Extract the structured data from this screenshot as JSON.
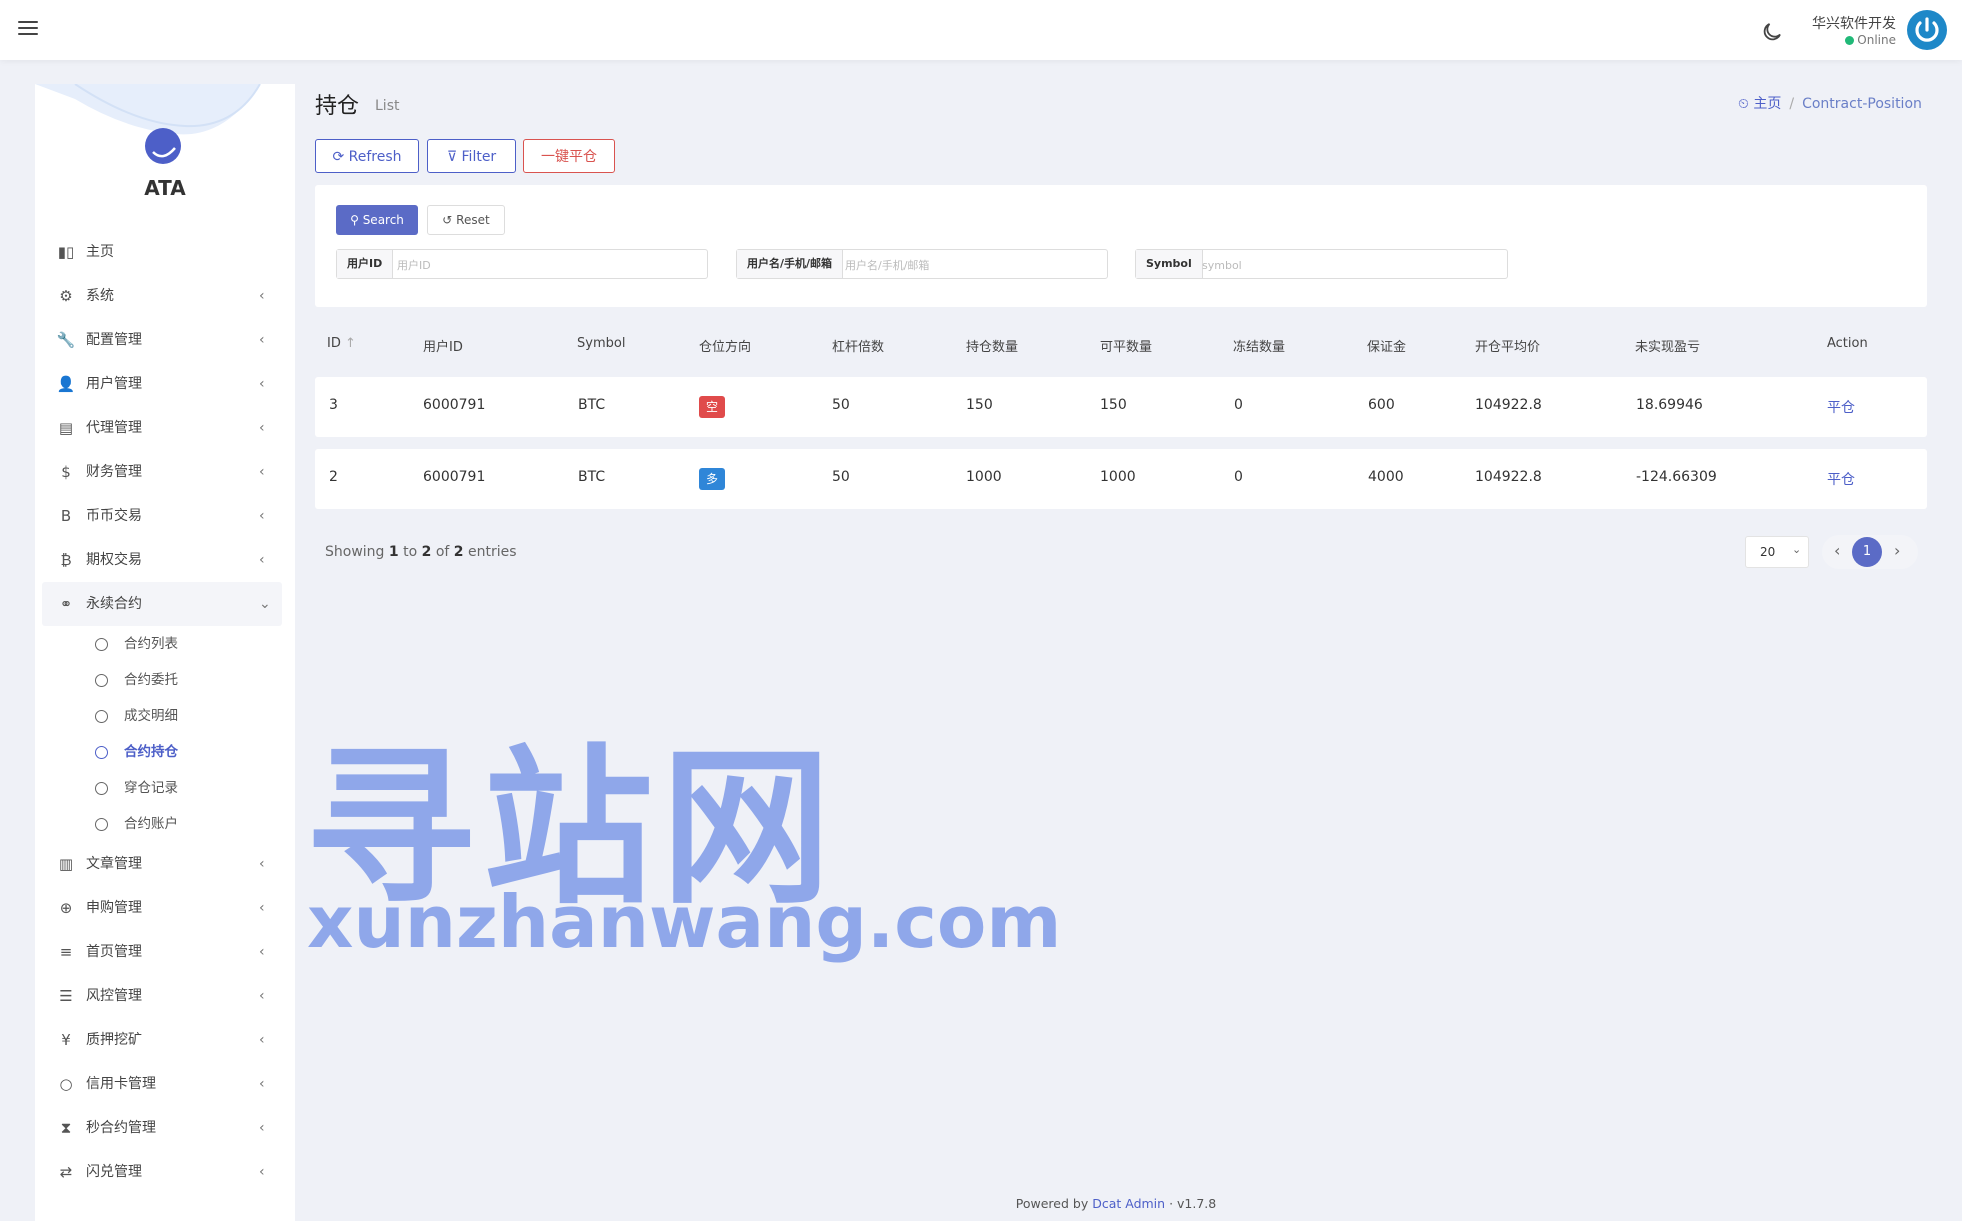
{
  "header": {
    "user_name": "华兴软件开发",
    "user_status": "Online",
    "menu_icon": "hamburger-icon",
    "theme_icon": "moon-icon"
  },
  "sidebar": {
    "logo_text": "ATA",
    "items": [
      {
        "label": "主页",
        "icon": "bar-chart-icon",
        "has_children": false
      },
      {
        "label": "系统",
        "icon": "gear-icon",
        "has_children": true
      },
      {
        "label": "配置管理",
        "icon": "wrench-icon",
        "has_children": true
      },
      {
        "label": "用户管理",
        "icon": "user-tie-icon",
        "has_children": true
      },
      {
        "label": "代理管理",
        "icon": "id-card-icon",
        "has_children": true
      },
      {
        "label": "财务管理",
        "icon": "dollar-icon",
        "has_children": true
      },
      {
        "label": "币币交易",
        "icon": "bitcoin-b-icon",
        "has_children": true
      },
      {
        "label": "期权交易",
        "icon": "bitcoin-icon",
        "has_children": true
      },
      {
        "label": "永续合约",
        "icon": "link-icon",
        "has_children": true,
        "open": true,
        "children": [
          {
            "label": "合约列表",
            "active": false
          },
          {
            "label": "合约委托",
            "active": false
          },
          {
            "label": "成交明细",
            "active": false
          },
          {
            "label": "合约持仓",
            "active": true
          },
          {
            "label": "穿仓记录",
            "active": false
          },
          {
            "label": "合约账户",
            "active": false
          }
        ]
      },
      {
        "label": "文章管理",
        "icon": "newspaper-icon",
        "has_children": true
      },
      {
        "label": "申购管理",
        "icon": "life-ring-icon",
        "has_children": true
      },
      {
        "label": "首页管理",
        "icon": "bars-icon",
        "has_children": true
      },
      {
        "label": "风控管理",
        "icon": "outdent-icon",
        "has_children": true
      },
      {
        "label": "质押挖矿",
        "icon": "yen-icon",
        "has_children": true
      },
      {
        "label": "信用卡管理",
        "icon": "circle-icon",
        "has_children": true
      },
      {
        "label": "秒合约管理",
        "icon": "hourglass-icon",
        "has_children": true
      },
      {
        "label": "闪兑管理",
        "icon": "exchange-icon",
        "has_children": true
      }
    ]
  },
  "page": {
    "title": "持仓",
    "subtitle": "List",
    "breadcrumb_home": "主页",
    "breadcrumb_current": "Contract-Position"
  },
  "toolbar": {
    "refresh": "Refresh",
    "filter": "Filter",
    "close_all": "一键平仓"
  },
  "filter": {
    "search": "Search",
    "reset": "Reset",
    "fields": [
      {
        "label": "用户ID",
        "placeholder": "用户ID",
        "value": ""
      },
      {
        "label": "用户名/手机/邮箱",
        "placeholder": "用户名/手机/邮箱",
        "value": ""
      },
      {
        "label": "Symbol",
        "placeholder": "symbol",
        "value": ""
      }
    ]
  },
  "table": {
    "columns": [
      "ID",
      "用户ID",
      "Symbol",
      "仓位方向",
      "杠杆倍数",
      "持仓数量",
      "可平数量",
      "冻结数量",
      "保证金",
      "开仓平均价",
      "未实现盈亏",
      "Action"
    ],
    "rows": [
      {
        "id": "3",
        "user_id": "6000791",
        "symbol": "BTC",
        "side": "空",
        "side_type": "short",
        "leverage": "50",
        "position_qty": "150",
        "closable_qty": "150",
        "frozen_qty": "0",
        "margin": "600",
        "avg_price": "104922.8",
        "unrealized_pnl": "18.69946",
        "action": "平仓"
      },
      {
        "id": "2",
        "user_id": "6000791",
        "symbol": "BTC",
        "side": "多",
        "side_type": "long",
        "leverage": "50",
        "position_qty": "1000",
        "closable_qty": "1000",
        "frozen_qty": "0",
        "margin": "4000",
        "avg_price": "104922.8",
        "unrealized_pnl": "-124.66309",
        "action": "平仓"
      }
    ]
  },
  "pagination": {
    "showing_prefix": "Showing",
    "from": "1",
    "to_word": "to",
    "to": "2",
    "of_word": "of",
    "total": "2",
    "entries_word": "entries",
    "page_size": "20",
    "current_page": "1"
  },
  "watermark": {
    "cn": "寻站网",
    "en": "xunzhanwang.com"
  },
  "footer": {
    "powered_by": "Powered by",
    "link": "Dcat Admin",
    "separator": "·",
    "version": "v1.7.8"
  },
  "colors": {
    "primary": "#5b6bc6",
    "danger": "#d9534f",
    "short": "#e04b4b",
    "long": "#2f86d8",
    "online": "#21b978",
    "background": "#eff1f7"
  }
}
